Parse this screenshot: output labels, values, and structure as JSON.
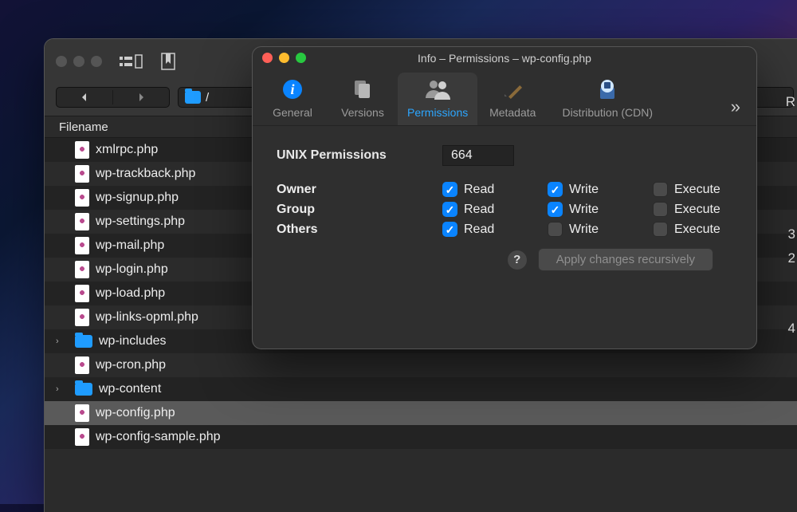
{
  "main": {
    "column_header": "Filename",
    "breadcrumb_path": "/",
    "files": [
      {
        "name": "xmlrpc.php",
        "kind": "php",
        "expandable": false,
        "selected": false
      },
      {
        "name": "wp-trackback.php",
        "kind": "php",
        "expandable": false,
        "selected": false
      },
      {
        "name": "wp-signup.php",
        "kind": "php",
        "expandable": false,
        "selected": false
      },
      {
        "name": "wp-settings.php",
        "kind": "php",
        "expandable": false,
        "selected": false
      },
      {
        "name": "wp-mail.php",
        "kind": "php",
        "expandable": false,
        "selected": false
      },
      {
        "name": "wp-login.php",
        "kind": "php",
        "expandable": false,
        "selected": false
      },
      {
        "name": "wp-load.php",
        "kind": "php",
        "expandable": false,
        "selected": false
      },
      {
        "name": "wp-links-opml.php",
        "kind": "php",
        "expandable": false,
        "selected": false
      },
      {
        "name": "wp-includes",
        "kind": "folder",
        "expandable": true,
        "selected": false
      },
      {
        "name": "wp-cron.php",
        "kind": "php",
        "expandable": false,
        "selected": false
      },
      {
        "name": "wp-content",
        "kind": "folder",
        "expandable": true,
        "selected": false
      },
      {
        "name": "wp-config.php",
        "kind": "php",
        "expandable": false,
        "selected": true
      },
      {
        "name": "wp-config-sample.php",
        "kind": "php",
        "expandable": false,
        "selected": false
      }
    ]
  },
  "info": {
    "title": "Info – Permissions – wp-config.php",
    "tabs": {
      "general": "General",
      "versions": "Versions",
      "permissions": "Permissions",
      "metadata": "Metadata",
      "distribution": "Distribution (CDN)"
    },
    "unix_label": "UNIX Permissions",
    "unix_value": "664",
    "scopes": {
      "owner": "Owner",
      "group": "Group",
      "others": "Others"
    },
    "perm_labels": {
      "read": "Read",
      "write": "Write",
      "execute": "Execute"
    },
    "perms": {
      "owner": {
        "read": true,
        "write": true,
        "execute": false
      },
      "group": {
        "read": true,
        "write": true,
        "execute": false
      },
      "others": {
        "read": true,
        "write": false,
        "execute": false
      }
    },
    "help_glyph": "?",
    "apply_label": "Apply changes recursively"
  },
  "right_edge": {
    "r1": "R",
    "r2": "3",
    "r3": "2",
    "r4": "4"
  }
}
